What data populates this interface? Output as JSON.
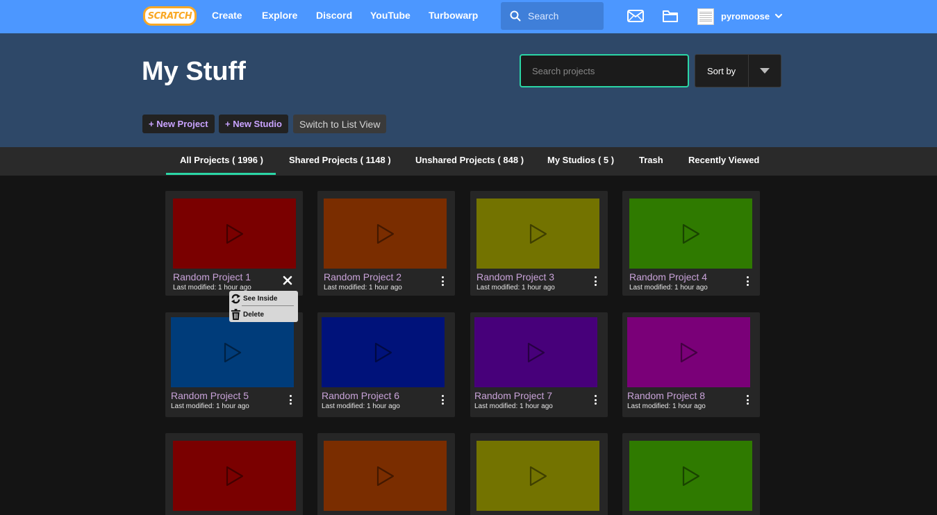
{
  "navbar": {
    "logo_text": "SCRATCH",
    "links": [
      "Create",
      "Explore",
      "Discord",
      "YouTube",
      "Turbowarp"
    ],
    "search_placeholder": "Search",
    "icons": [
      "search-icon",
      "messages-icon",
      "my-stuff-folder-icon",
      "chevron-down-icon"
    ],
    "username": "pyromoose"
  },
  "header": {
    "title": "My Stuff",
    "search_placeholder": "Search projects",
    "sort_label": "Sort by",
    "new_project": "+ New Project",
    "new_studio": "+ New Studio",
    "switch_view": "Switch to List View"
  },
  "tabs": [
    "All Projects ( 1996 )",
    "Shared Projects ( 1148 )",
    "Unshared Projects ( 848 )",
    "My Studios ( 5 )",
    "Trash",
    "Recently Viewed"
  ],
  "active_tab": 0,
  "projects": [
    {
      "title": "Random Project 1",
      "meta": "Last modified: 1 hour ago",
      "color": "#7a0000"
    },
    {
      "title": "Random Project 2",
      "meta": "Last modified: 1 hour ago",
      "color": "#7a2d00"
    },
    {
      "title": "Random Project 3",
      "meta": "Last modified: 1 hour ago",
      "color": "#737300"
    },
    {
      "title": "Random Project 4",
      "meta": "Last modified: 1 hour ago",
      "color": "#2f7a00"
    },
    {
      "title": "Random Project 5",
      "meta": "Last modified: 1 hour ago",
      "color": "#003c7a"
    },
    {
      "title": "Random Project 6",
      "meta": "Last modified: 1 hour ago",
      "color": "#00127a"
    },
    {
      "title": "Random Project 7",
      "meta": "Last modified: 1 hour ago",
      "color": "#47007a"
    },
    {
      "title": "Random Project 8",
      "meta": "Last modified: 1 hour ago",
      "color": "#7a0078"
    },
    {
      "title": "",
      "meta": "",
      "color": "#7a0000"
    },
    {
      "title": "",
      "meta": "",
      "color": "#7a2d00"
    },
    {
      "title": "",
      "meta": "",
      "color": "#737300"
    },
    {
      "title": "",
      "meta": "",
      "color": "#2f7a00"
    }
  ],
  "context_menu": {
    "items": [
      {
        "label": "See Inside",
        "icon": "remix-arrows-icon"
      },
      {
        "label": "Delete",
        "icon": "trash-icon"
      }
    ]
  },
  "colors": {
    "navbar": "#4c97ff",
    "header": "#2e4868",
    "accent": "#2bd6a6",
    "title_purple": "#c9a3d9"
  }
}
